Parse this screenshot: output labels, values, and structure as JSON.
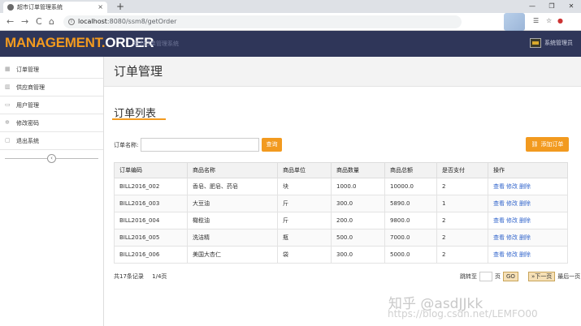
{
  "browser": {
    "tab_title": "超市订单管理系统",
    "tab_close": "×",
    "new_tab": "+",
    "url_host": "localhost",
    "url_path": ":8080/ssm8/getOrder",
    "nav_back": "←",
    "nav_forward": "→",
    "nav_reload": "C",
    "nav_home": "⌂",
    "win_min": "—",
    "win_max": "❐",
    "win_close": "✕"
  },
  "header": {
    "brand_left": "MANAGEMENT.",
    "brand_right": "ORDER",
    "tagline": "超市订单管理系统",
    "user_label": "系统管理员"
  },
  "sidebar": {
    "items": [
      {
        "label": "订单管理"
      },
      {
        "label": "供应商管理"
      },
      {
        "label": "用户管理"
      },
      {
        "label": "修改密码"
      },
      {
        "label": "退出系统"
      }
    ],
    "collapse_glyph": "‹"
  },
  "main": {
    "page_title": "订单管理",
    "section_title": "订单列表",
    "search_label": "订单名称:",
    "search_value": "",
    "search_button": "查询",
    "add_button": "添加订单",
    "add_icon": "🔗",
    "columns": [
      "订单编码",
      "商品名称",
      "商品单位",
      "商品数量",
      "商品总额",
      "是否支付",
      "操作"
    ],
    "rows": [
      {
        "code": "BILL2016_002",
        "name": "香皂、肥皂、药皂",
        "unit": "块",
        "qty": "1000.0",
        "total": "10000.0",
        "paid": "2"
      },
      {
        "code": "BILL2016_003",
        "name": "大豆油",
        "unit": "斤",
        "qty": "300.0",
        "total": "5890.0",
        "paid": "1"
      },
      {
        "code": "BILL2016_004",
        "name": "橄榄油",
        "unit": "斤",
        "qty": "200.0",
        "total": "9800.0",
        "paid": "2"
      },
      {
        "code": "BILL2016_005",
        "name": "洗洁精",
        "unit": "瓶",
        "qty": "500.0",
        "total": "7000.0",
        "paid": "2"
      },
      {
        "code": "BILL2016_006",
        "name": "美国大杏仁",
        "unit": "袋",
        "qty": "300.0",
        "total": "5000.0",
        "paid": "2"
      }
    ],
    "op_view": "查看",
    "op_edit": "修改",
    "op_delete": "删除"
  },
  "footer": {
    "record_count": "共17条记录",
    "page_info": "1/4页",
    "jump_label": "跳转至",
    "page_unit": "页",
    "go_button": "GO",
    "next_button": "»下一页",
    "last_button": "最后一页"
  },
  "watermark": {
    "line1": "知乎 @asdJJkk",
    "line2": "https://blog.csdn.net/LEMFO00"
  },
  "colors": {
    "accent": "#f29a1f",
    "header_bg": "#2f3659",
    "link": "#3366cc"
  }
}
